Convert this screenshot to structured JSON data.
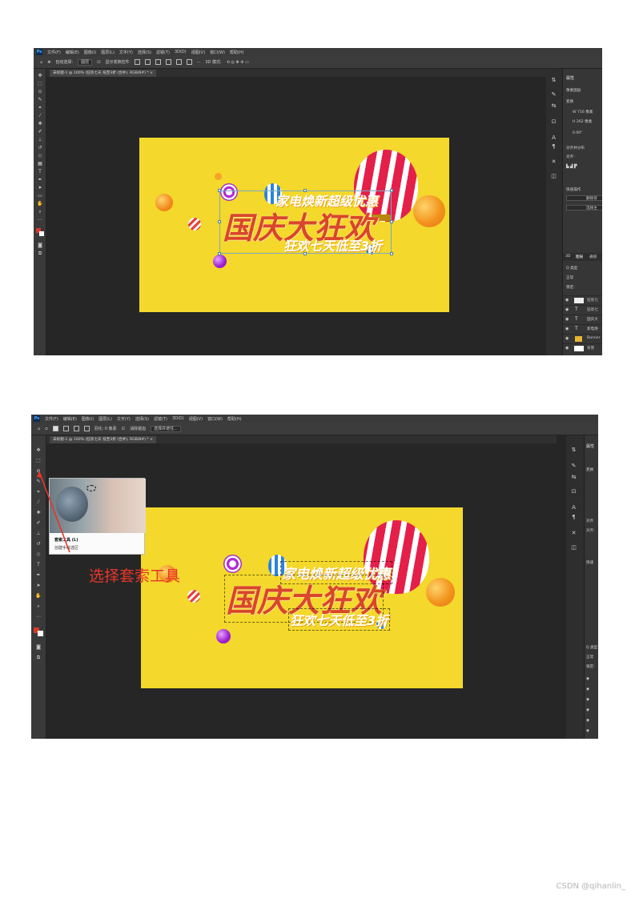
{
  "screenshot1": {
    "menu": [
      "文件(F)",
      "编辑(E)",
      "图像(I)",
      "图层(L)",
      "文字(Y)",
      "选择(S)",
      "滤镜(T)",
      "3D(D)",
      "视图(V)",
      "窗口(W)",
      "帮助(H)"
    ],
    "options": {
      "auto_select": "自动选择:",
      "layer_dropdown": "图层",
      "show_transform": "显示变换控件",
      "mode_3d": "3D 模式:"
    },
    "doc_tab": "未标题-1 @ 100% (狂欢七天 低至3折 (合并), RGB/8#) * ×",
    "panel": {
      "tab_properties": "属性",
      "pixel_layer": "像素图层",
      "transform": "变换",
      "w_value": "W 716 像素",
      "h_value": "H 262 像素",
      "angle": "0.00°",
      "align": "对齐并分布",
      "align_label": "对齐:",
      "quick_actions": "快速操作",
      "btn_remove_bg": "删除背",
      "btn_select_subject": "选择主",
      "layers_tabs": [
        "3D",
        "图层",
        "通道"
      ],
      "kind_label": "Q 类型",
      "blend_mode": "正常",
      "lock_label": "锁定:",
      "layers": [
        {
          "type": "img",
          "name": "狂欢七"
        },
        {
          "type": "T",
          "name": "狂欢七"
        },
        {
          "type": "T",
          "name": "国庆大"
        },
        {
          "type": "T",
          "name": "家电焕"
        },
        {
          "type": "folder",
          "name": "Banner"
        },
        {
          "type": "img",
          "name": "背景"
        }
      ]
    }
  },
  "screenshot2": {
    "menu": [
      "文件(F)",
      "编辑(E)",
      "图像(I)",
      "图层(L)",
      "文字(Y)",
      "选择(S)",
      "滤镜(T)",
      "3D(D)",
      "视图(V)",
      "窗口(W)",
      "帮助(H)"
    ],
    "options": {
      "feather": "羽化: 0 像素",
      "antialias": "消除锯齿",
      "select_mask": "选择并遮住..."
    },
    "doc_tab": "未标题-1 @ 100% (狂欢七天 低至3折 (合并), RGB/8#) * ×",
    "tooltip": {
      "title": "套索工具 (L)",
      "desc": "创建手绘选区"
    },
    "callout": "选择套索工具",
    "panel": {
      "tab_properties": "属性",
      "transform": "变换",
      "align": "对齐",
      "align_label": "对齐:",
      "quick_actions": "快速",
      "kind_label": "Q 类型",
      "blend_mode": "正常",
      "lock_label": "锁定:"
    }
  },
  "banner": {
    "line1": "家电焕新超级优惠",
    "line2": "国庆大狂欢",
    "line3": "狂欢七天低至3折"
  },
  "colors": {
    "banner_bg": "#f4d82b",
    "title_red": "#d9462a",
    "ps_dark": "#262626",
    "callout_red": "#e8352b"
  },
  "watermark": "CSDN @qihanlin_"
}
